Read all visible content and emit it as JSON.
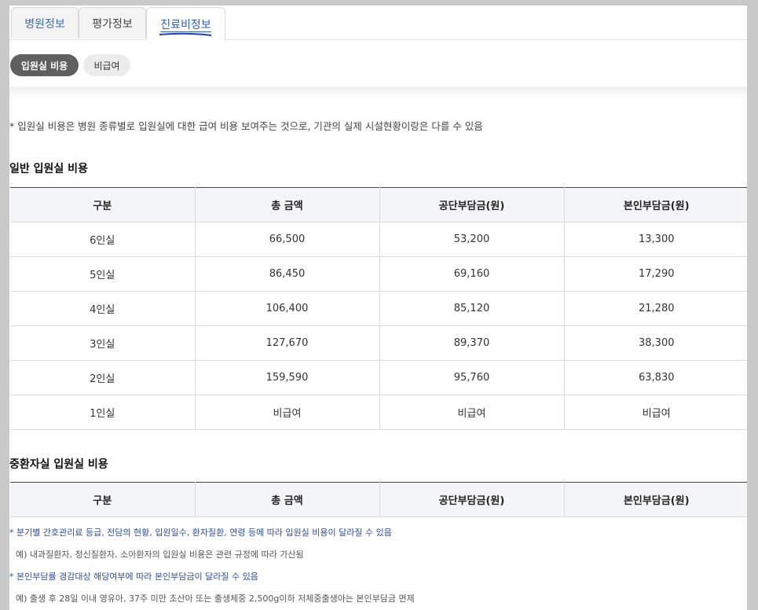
{
  "tabs": [
    {
      "label": "병원정보",
      "active": false
    },
    {
      "label": "평가정보",
      "active": false
    },
    {
      "label": "진료비정보",
      "active": true
    }
  ],
  "subtabs": [
    {
      "label": "입원실 비용",
      "active": true
    },
    {
      "label": "비급여",
      "active": false
    }
  ],
  "notice": "* 입원실 비용은 병원 종류별로 입원실에 대한 급여 비용 보여주는 것으로, 기관의 실제 시설현황이랑은 다를 수 있음",
  "general": {
    "title": "일반 입원실 비용",
    "headers": [
      "구분",
      "총 금액",
      "공단부담금(원)",
      "본인부담금(원)"
    ],
    "rows": [
      [
        "6인실",
        "66,500",
        "53,200",
        "13,300"
      ],
      [
        "5인실",
        "86,450",
        "69,160",
        "17,290"
      ],
      [
        "4인실",
        "106,400",
        "85,120",
        "21,280"
      ],
      [
        "3인실",
        "127,670",
        "89,370",
        "38,300"
      ],
      [
        "2인실",
        "159,590",
        "95,760",
        "63,830"
      ],
      [
        "1인실",
        "비급여",
        "비급여",
        "비급여"
      ]
    ]
  },
  "icu": {
    "title": "중환자실 입원실 비용",
    "headers": [
      "구분",
      "총 금액",
      "공단부담금(원)",
      "본인부담금(원)"
    ]
  },
  "notes": {
    "n1": "* 분기별 간호관리료 등급, 전담의 현황, 입원일수, 환자질환, 연령 등에 따라 입원실 비용이 달라질 수 있음",
    "n2": "예) 내과질환자, 정신질환자, 소아환자의 입원실 비용은 관련 규정에 따라 가산됨",
    "n3": "* 본인부담률 경감대상 해당여부에 따라 본인부담금이 달라질 수 있음",
    "n4": "예) 출생 후 28일 이내 영유아, 37주 미만 조산아 또는 출생체중 2,500g이하 저체중출생아는 본인부담금 면제"
  },
  "colors": {
    "accent": "#2a5fc4",
    "pill_active": "#5f5f5f",
    "header_bg": "#f4f5f7",
    "underline": "#1a3fd0"
  }
}
